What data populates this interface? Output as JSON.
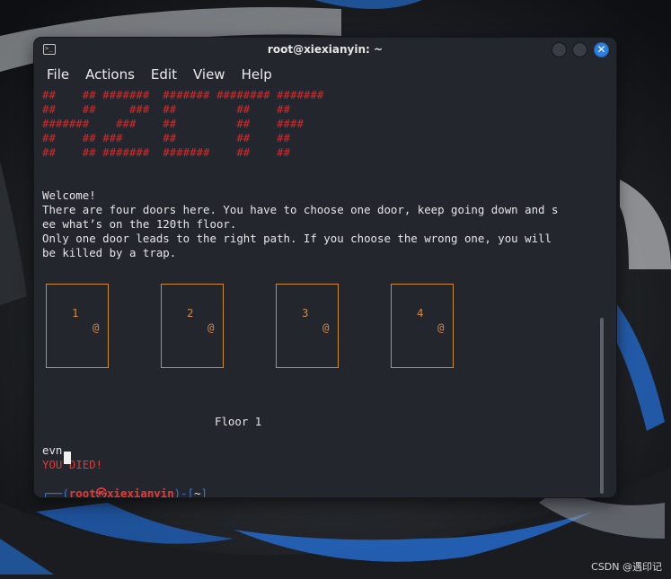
{
  "window": {
    "title": "root@xiexianyin: ~"
  },
  "menu": [
    "File",
    "Actions",
    "Edit",
    "View",
    "Help"
  ],
  "terminal": {
    "banner": [
      "##    ## #######  ####### ######## #######",
      "##    ##     ###  ##         ##    ##",
      "#######    ###    ##         ##    ####",
      "##    ## ###      ##         ##    ##",
      "##    ## #######  #######    ##    ##"
    ],
    "intro": [
      "Welcome!",
      "There are four doors here. You have to choose one door, keep going down and s",
      "ee what’s on the 120th floor.",
      "Only one door leads to the right path. If you choose the wrong one, you will",
      "be killed by a trap."
    ],
    "doors": [
      {
        "number": "1",
        "knob": "@"
      },
      {
        "number": "2",
        "knob": "@"
      },
      {
        "number": "3",
        "knob": "@"
      },
      {
        "number": "4",
        "knob": "@"
      }
    ],
    "floor_label": "Floor 1",
    "input": "evn",
    "result": "YOU DIED!",
    "prompt": {
      "frame_open": "┌──(",
      "user": "root㉿xiexianyin",
      "frame_mid": ")-[",
      "path": "~",
      "frame_close": "]",
      "second_line": "└─",
      "symbol": "#"
    }
  },
  "watermark": "CSDN @遇印记",
  "colors": {
    "terminal_bg": "#24262e",
    "banner_red": "#d42a2a",
    "door_orange": "#d1893a",
    "prompt_blue": "#2f7de0",
    "close_button": "#2d7fe0"
  }
}
